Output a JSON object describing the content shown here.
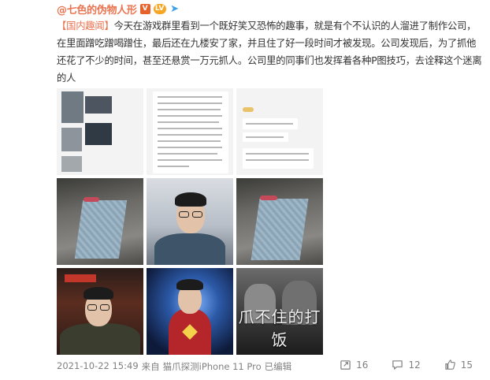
{
  "post": {
    "author": "@七色的伪物人形",
    "badges": {
      "verified": "V",
      "level": "LV"
    },
    "tag": "【国内趣闻】",
    "text": "今天在游戏群里看到一个既好笑又恐怖的趣事，就是有个不认识的人溜进了制作公司，在里面蹭吃蹭喝蹭住，最后还在九楼安了家，并且住了好一段时间才被发现。公司发现后，为了抓他还花了不少的时间，甚至还悬赏一万元抓人。公司里的同事们也发挥着各种P图技巧，去诠释这个迷离的人",
    "poster_caption": "爪不住的打饭",
    "footer": {
      "datetime": "2021-10-22 15:49",
      "source_prefix": "来自",
      "source": "猫爪探测iPhone 11 Pro",
      "edited": "已编辑"
    },
    "actions": {
      "repost": "16",
      "comment": "12",
      "like": "15"
    }
  },
  "colors": {
    "author": "#eb7350",
    "tag": "#eb7350",
    "meta": "#808080"
  }
}
